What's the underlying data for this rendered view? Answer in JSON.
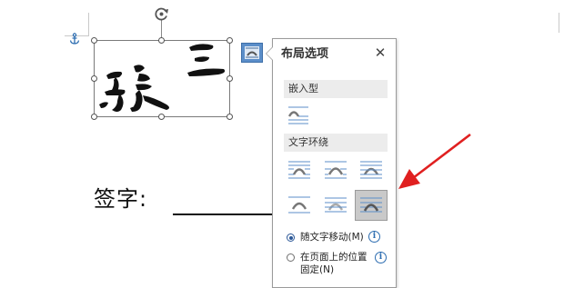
{
  "document": {
    "signature_label": "签字:"
  },
  "image": {
    "signature_text": "張三"
  },
  "layout_panel": {
    "title": "布局选项",
    "close_glyph": "✕",
    "section_inline": "嵌入型",
    "section_wrap": "文字环绕",
    "wrap_options": [
      {
        "name": "square",
        "selected": false
      },
      {
        "name": "tight",
        "selected": false
      },
      {
        "name": "through",
        "selected": false
      },
      {
        "name": "top-and-bottom",
        "selected": false
      },
      {
        "name": "behind-text",
        "selected": false
      },
      {
        "name": "in-front-of-text",
        "selected": true
      }
    ],
    "radio_move_with_text": "随文字移动(M)",
    "radio_fixed_line1": "在页面上的位置",
    "radio_fixed_line2": "固定(N)",
    "move_with_text_checked": true,
    "info_glyph": "i"
  },
  "icons": [
    "anchor-icon",
    "rotate-icon",
    "layout-options-icon",
    "close-icon",
    "info-icon"
  ],
  "colors": {
    "accent_blue": "#2b6cb0",
    "layout_button": "#5b8ec9",
    "annotation_red": "#e02020",
    "wrap_lines": "#5b8ec9",
    "wrap_shape": "#777777"
  }
}
